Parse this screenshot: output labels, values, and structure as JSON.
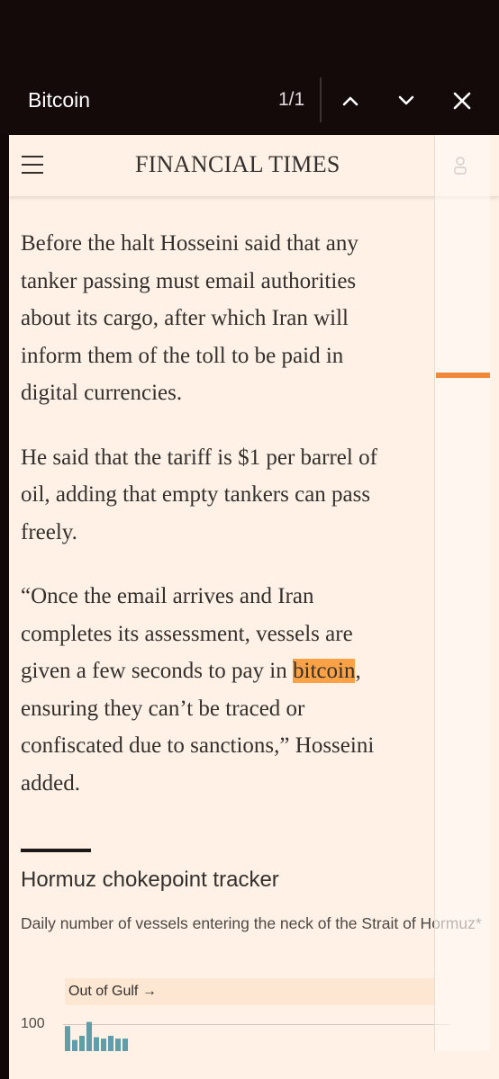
{
  "find_bar": {
    "query": "Bitcoin",
    "match_count": "1/1",
    "prev_icon": "chevron-up-icon",
    "next_icon": "chevron-down-icon",
    "close_icon": "close-icon"
  },
  "header": {
    "brand": "FINANCIAL TIMES",
    "menu_icon": "hamburger-menu-icon",
    "account_icon": "user-icon"
  },
  "article": {
    "paragraphs": [
      {
        "lines": [
          "Before the halt Hosseini said that any",
          "tanker passing must email authorities",
          "about its cargo, after which Iran will",
          "inform them of the toll to be paid in",
          "digital currencies."
        ]
      },
      {
        "lines": [
          "He said that the tariff is $1 per barrel of",
          "oil, adding that empty tankers can pass",
          "freely."
        ]
      },
      {
        "lines": [
          "“Once the email arrives and Iran",
          "completes its assessment, vessels are"
        ],
        "highlight_line": {
          "before": "given a few seconds to pay in ",
          "match": "bitcoin",
          "after": ","
        },
        "lines_after": [
          "ensuring they can’t be traced or",
          "confiscated due to sanctions,” Hosseini",
          "added."
        ]
      }
    ]
  },
  "tracker": {
    "title": "Hormuz chokepoint tracker",
    "subtitle": "Daily number of vessels entering the neck of the Strait of Hormuz*",
    "series_label": "Out of Gulf →",
    "y_tick": "100"
  },
  "chart_data": {
    "type": "bar",
    "title": "Hormuz chokepoint tracker",
    "subtitle": "Daily number of vessels entering the neck of the Strait of Hormuz*",
    "series": [
      {
        "name": "Out of Gulf →",
        "values": [
          90,
          40,
          55,
          105,
          50,
          45,
          55,
          45,
          45
        ]
      }
    ],
    "y_ticks": [
      "100"
    ],
    "ylim": [
      0,
      110
    ],
    "bar_color": "#5e9ea8"
  },
  "colors": {
    "highlight": "#fca146",
    "page_background": "#fff1e5",
    "find_bar_background": "#150a0a",
    "scroll_marker": "#f08a3a"
  }
}
